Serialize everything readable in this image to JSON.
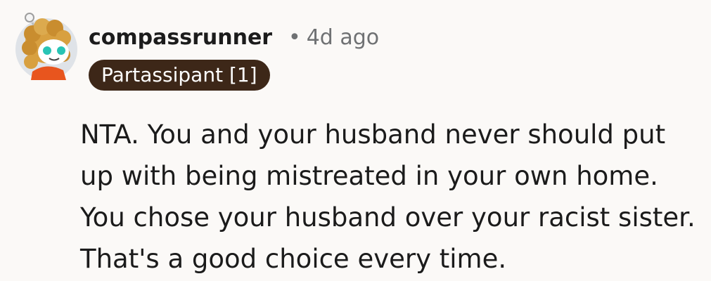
{
  "comment": {
    "author": {
      "username": "compassrunner",
      "avatar_icon": "snoo-avatar-icon",
      "flair": "Partassipant [1]",
      "flair_color": "#3d2718"
    },
    "separator": "•",
    "timestamp": "4d ago",
    "body": [
      "NTA. You and your husband never should put",
      "up with being mistreated in your own home.",
      "You chose your husband over your racist sister.",
      "That's a good choice every time."
    ]
  }
}
